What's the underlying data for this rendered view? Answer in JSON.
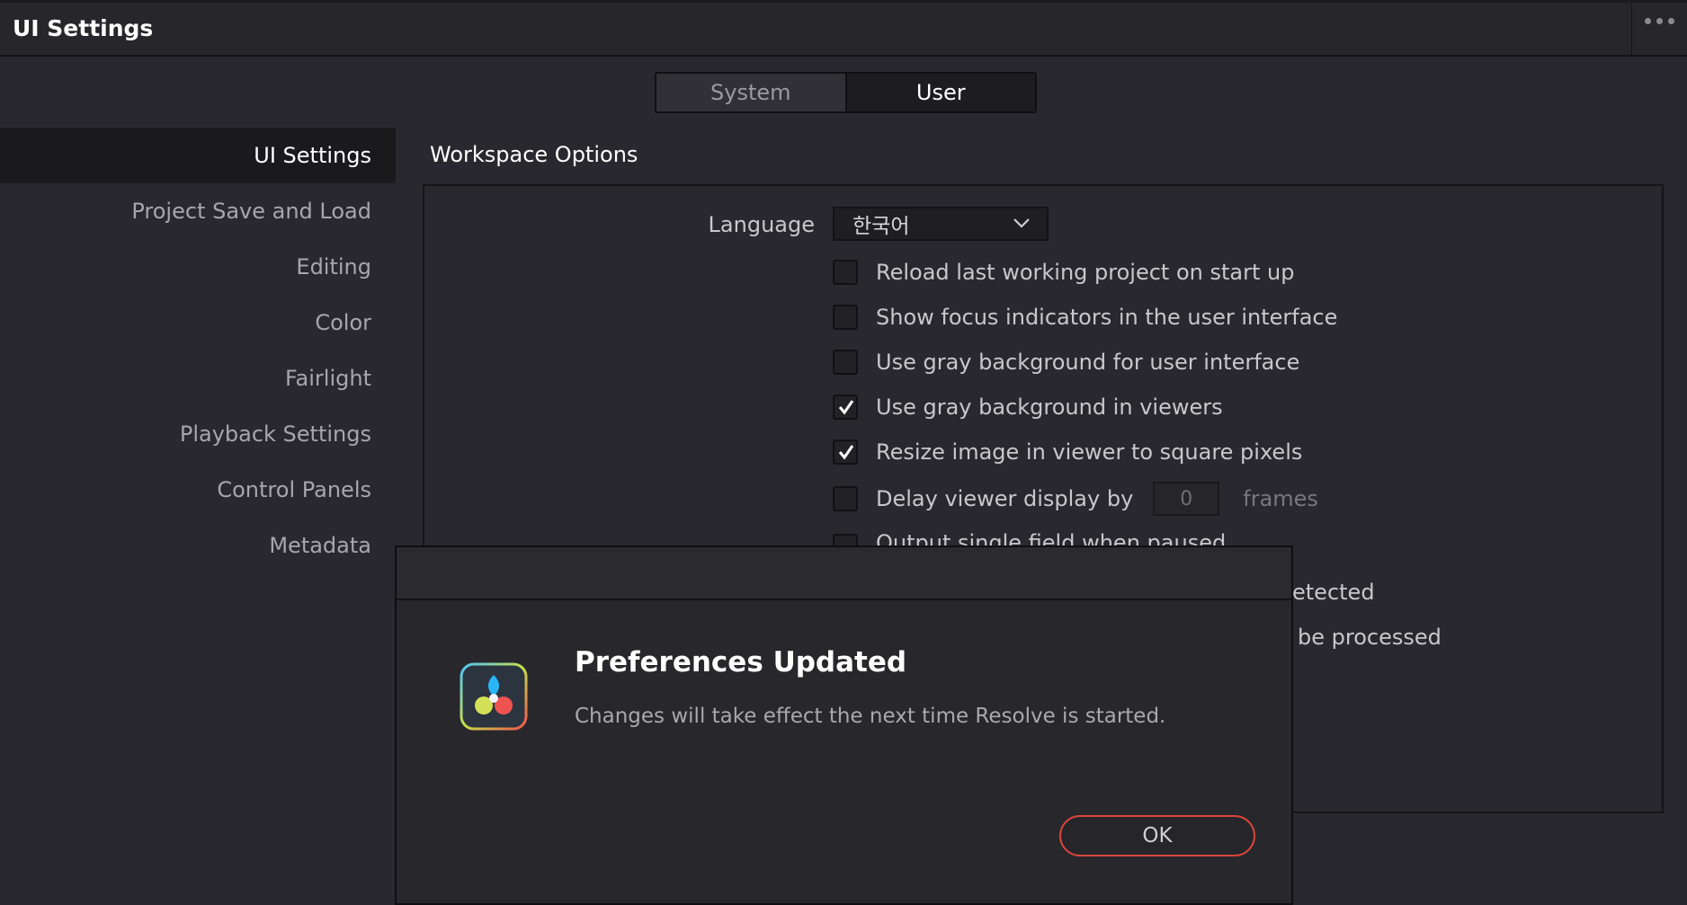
{
  "window": {
    "title": "UI Settings"
  },
  "tabs": {
    "system": "System",
    "user": "User",
    "active": "User"
  },
  "sidebar": {
    "items": [
      {
        "label": "UI Settings",
        "active": true
      },
      {
        "label": "Project Save and Load"
      },
      {
        "label": "Editing"
      },
      {
        "label": "Color"
      },
      {
        "label": "Fairlight"
      },
      {
        "label": "Playback Settings"
      },
      {
        "label": "Control Panels"
      },
      {
        "label": "Metadata"
      }
    ]
  },
  "workspace": {
    "title": "Workspace Options",
    "language_label": "Language",
    "language_value": "한국어",
    "options": [
      {
        "label": "Reload last working project on start up",
        "checked": false
      },
      {
        "label": "Show focus indicators in the user interface",
        "checked": false
      },
      {
        "label": "Use gray background for user interface",
        "checked": false
      },
      {
        "label": "Use gray background in viewers",
        "checked": true
      },
      {
        "label": "Resize image in viewer to square pixels",
        "checked": true
      }
    ],
    "delay": {
      "label": "Delay viewer display by",
      "value": "0",
      "unit": "frames",
      "checked": false
    },
    "partial": {
      "line1": "Output single field when paused",
      "line2": "etected",
      "line3": "be processed"
    }
  },
  "dialog": {
    "title": "Preferences Updated",
    "message": "Changes will take effect the next time Resolve is started.",
    "ok": "OK"
  },
  "colors": {
    "accent_red": "#d9463a",
    "background": "#28282e"
  }
}
